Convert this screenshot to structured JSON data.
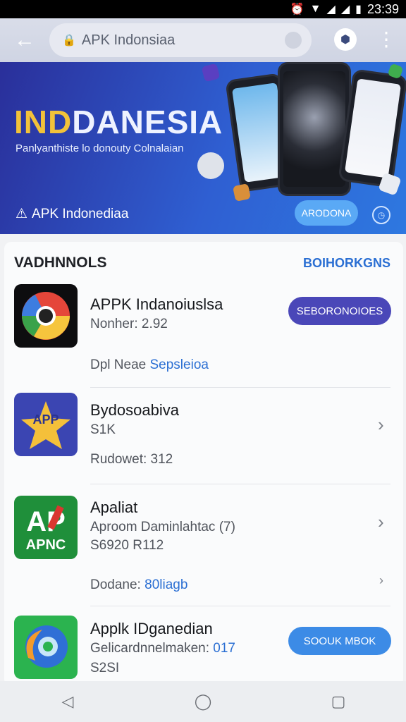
{
  "status_bar": {
    "time": "23:39"
  },
  "browser": {
    "url": "APK Indonsiaa"
  },
  "banner": {
    "title_part1": "IND",
    "title_part2": "DANESIA",
    "subtitle": "Panlyanthiste lo donouty Colnalaian",
    "brand": "APK Indonediaa",
    "cta_label": "ARODONA"
  },
  "section": {
    "title": "VADHNNOLS",
    "link": "BOIHORKGNS"
  },
  "apps": [
    {
      "name": "APPK Indanoiuslsa",
      "meta1": "Nonher: 2.92",
      "meta2_label": "Dpl Neae",
      "meta2_link": "Sepsleioa",
      "button": "SEBORONOIOES"
    },
    {
      "name": "Bydosoabiva",
      "meta1": "S1K",
      "meta2_label": "Rudowet: 312"
    },
    {
      "name": "Apaliat",
      "meta1": "Aproom Daminlahtac (7)",
      "meta2_label": "S6920 R112",
      "meta3_label": "Dodane:",
      "meta3_link": "80liagb",
      "icon_text_top": "AP",
      "icon_text_bottom": "APNC"
    },
    {
      "name": "Applk IDganedian",
      "meta1_label": "Gelicardnnelmaken:",
      "meta1_link": "017",
      "meta2_label": "S2SI",
      "button": "SOOUK MBOK"
    }
  ],
  "icon_labels": {
    "app2": "APP"
  },
  "colors": {
    "accent": "#2b6fd3",
    "banner": "#2f5fd2",
    "primary_button": "#4a47b8",
    "secondary_button": "#3c8be6",
    "title_yellow": "#f2c23a"
  }
}
